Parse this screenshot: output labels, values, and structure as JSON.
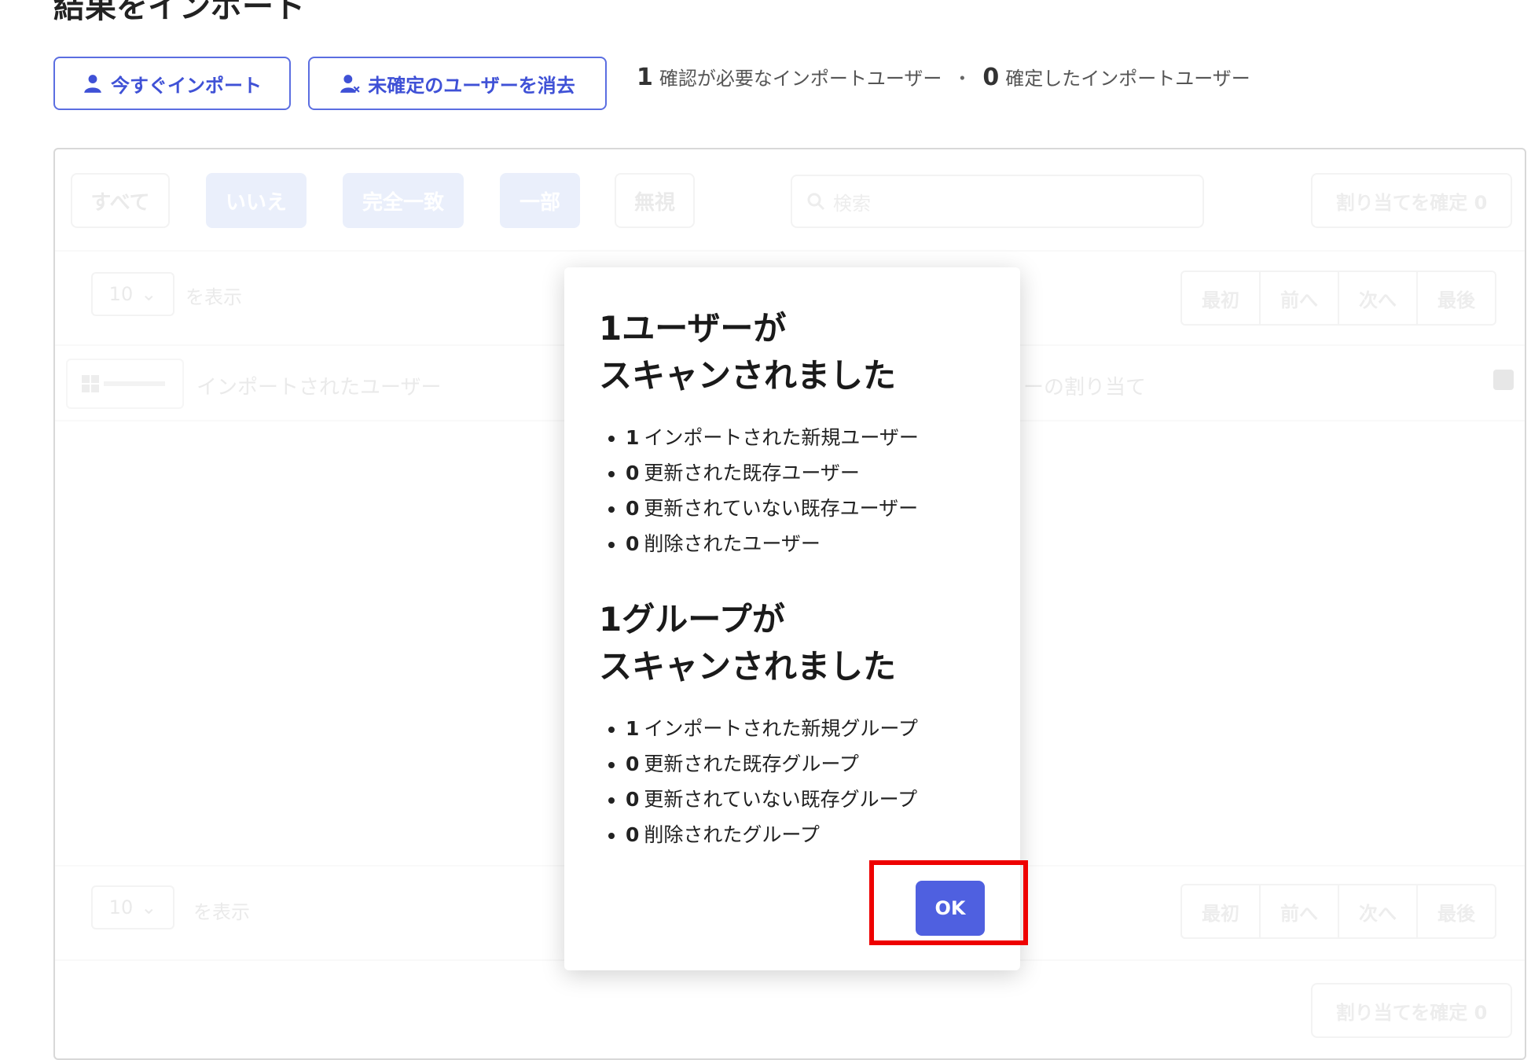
{
  "header": {
    "title": "結果をインポート",
    "import_now": "今すぐインポート",
    "clear_unconfirmed": "未確定のユーザーを消去",
    "stats": {
      "pending_count": "1",
      "pending_label": "確認が必要なインポートユーザー",
      "separator": "・",
      "confirmed_count": "0",
      "confirmed_label": "確定したインポートユーザー"
    }
  },
  "background": {
    "filters": [
      "すべて",
      "いいえ",
      "完全一致",
      "一部",
      "無視"
    ],
    "search_placeholder": "検索",
    "confirm_button": "割り当てを確定 0",
    "page_size": "10",
    "page_size_label": "を表示",
    "pager": [
      "最初",
      "前へ",
      "次へ",
      "最後"
    ],
    "col_imported": "インポートされたユーザー",
    "col_assign": "ーの割り当て"
  },
  "modal": {
    "users_title_line1": "1ユーザーが",
    "users_title_line2": "スキャンされました",
    "user_items": [
      {
        "count": "1",
        "label": "インポートされた新規ユーザー"
      },
      {
        "count": "0",
        "label": "更新された既存ユーザー"
      },
      {
        "count": "0",
        "label": "更新されていない既存ユーザー"
      },
      {
        "count": "0",
        "label": "削除されたユーザー"
      }
    ],
    "groups_title_line1": "1グループが",
    "groups_title_line2": "スキャンされました",
    "group_items": [
      {
        "count": "1",
        "label": "インポートされた新規グループ"
      },
      {
        "count": "0",
        "label": "更新された既存グループ"
      },
      {
        "count": "0",
        "label": "更新されていない既存グループ"
      },
      {
        "count": "0",
        "label": "削除されたグループ"
      }
    ],
    "ok_label": "OK"
  },
  "colors": {
    "accent": "#4f60e0",
    "highlight": "#ee0000"
  }
}
